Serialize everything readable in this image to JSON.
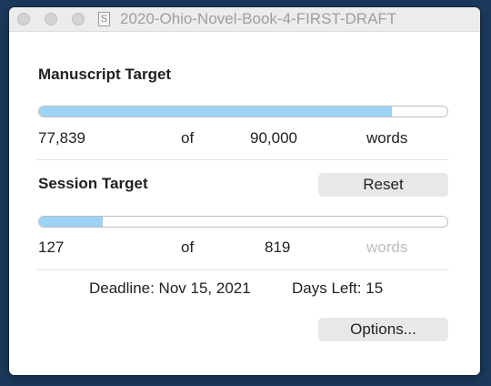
{
  "window": {
    "title": "2020-Ohio-Novel-Book-4-FIRST-DRAFT",
    "doc_icon_glyph": "S"
  },
  "manuscript": {
    "heading": "Manuscript Target",
    "current": "77,839",
    "of": "of",
    "target": "90,000",
    "unit": "words",
    "progress_fraction": 0.865
  },
  "session": {
    "heading": "Session Target",
    "reset_label": "Reset",
    "current": "127",
    "of": "of",
    "target": "819",
    "unit": "words",
    "progress_fraction": 0.155
  },
  "deadline": {
    "text": "Deadline: Nov 15, 2021",
    "days_left": "Days Left: 15"
  },
  "options_label": "Options...",
  "colors": {
    "progress_fill": "#9dd3f5",
    "background": "#1b3a5c"
  }
}
